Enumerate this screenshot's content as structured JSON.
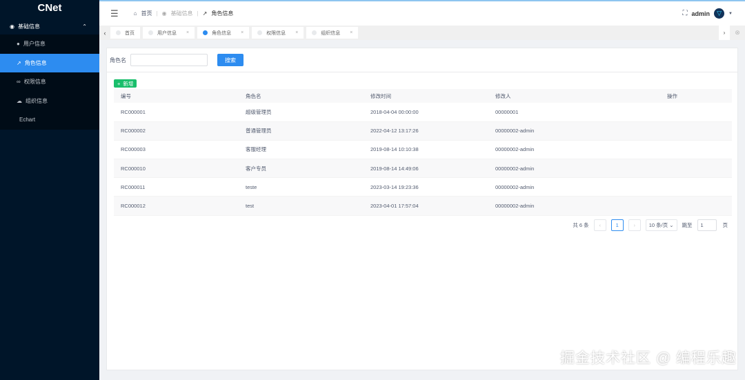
{
  "app": {
    "title": "CNet"
  },
  "sidebar": {
    "parent": "基础信息",
    "items": [
      {
        "label": "用户信息",
        "icon": "user-icon"
      },
      {
        "label": "角色信息",
        "icon": "trend-icon",
        "active": true
      },
      {
        "label": "权限信息",
        "icon": "link-icon"
      },
      {
        "label": "组织信息",
        "icon": "org-icon"
      },
      {
        "label": "Echart"
      }
    ]
  },
  "header": {
    "breadcrumb": [
      "首页",
      "基础信息",
      "角色信息"
    ],
    "user": "admin"
  },
  "tabs": [
    {
      "label": "首页"
    },
    {
      "label": "用户信息"
    },
    {
      "label": "角色信息",
      "active": true
    },
    {
      "label": "权限信息"
    },
    {
      "label": "组织信息"
    }
  ],
  "search": {
    "label": "角色名",
    "value": "",
    "button": "搜索"
  },
  "add_button": "新增",
  "table": {
    "columns": [
      "编号",
      "角色名",
      "修改时间",
      "修改人",
      "操作"
    ],
    "rows": [
      [
        "RC000001",
        "超级管理员",
        "2018-04-04 00:00:00",
        "00000001"
      ],
      [
        "RC000002",
        "普通管理员",
        "2022-04-12 13:17:26",
        "00000002-admin"
      ],
      [
        "RC000003",
        "客服经理",
        "2019-08-14 10:10:38",
        "00000002-admin"
      ],
      [
        "RC000010",
        "客户专员",
        "2019-08-14 14:49:06",
        "00000002-admin"
      ],
      [
        "RC000011",
        "teste",
        "2023-03-14 19:23:36",
        "00000002-admin"
      ],
      [
        "RC000012",
        "test",
        "2023-04-01 17:57:04",
        "00000002-admin"
      ]
    ]
  },
  "pagination": {
    "total": "共 6 条",
    "current": "1",
    "page_size": "10 条/页",
    "jump_label": "跳至",
    "jump_value": "1",
    "page_suffix": "页"
  },
  "watermark": "掘金技术社区 @ 编程乐趣"
}
